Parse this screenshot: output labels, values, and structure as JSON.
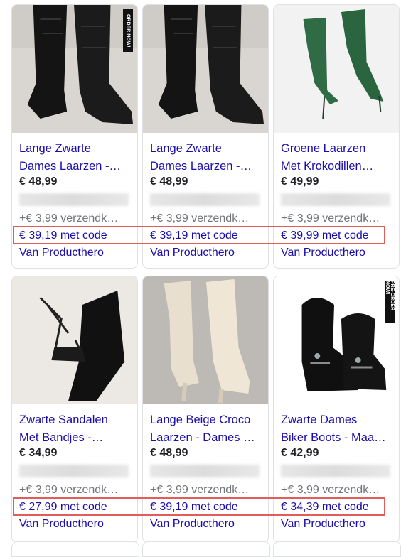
{
  "products": [
    {
      "title_line1": "Lange Zwarte",
      "title_line2": "Dames Laarzen -…",
      "price": "€ 48,99",
      "shipping": "+€ 3,99 verzendk…",
      "code_price": "€ 39,19 met code",
      "seller": "Van Producthero",
      "badge": "ORDER NOW!",
      "image": "black-croc-knee-boots"
    },
    {
      "title_line1": "Lange Zwarte",
      "title_line2": "Dames Laarzen -…",
      "price": "€ 48,99",
      "shipping": "+€ 3,99 verzendk…",
      "code_price": "€ 39,19 met code",
      "seller": "Van Producthero",
      "badge": "",
      "image": "black-croc-knee-boots"
    },
    {
      "title_line1": "Groene Laarzen",
      "title_line2": "Met Krokodillen…",
      "price": "€ 49,99",
      "shipping": "+€ 3,99 verzendk…",
      "code_price": "€ 39,99 met code",
      "seller": "Van Producthero",
      "badge": "",
      "image": "green-croc-stiletto-boots"
    },
    {
      "title_line1": "Zwarte Sandalen",
      "title_line2": "Met Bandjes -…",
      "price": "€ 34,99",
      "shipping": "+€ 3,99 verzendk…",
      "code_price": "€ 27,99 met code",
      "seller": "Van Producthero",
      "badge": "",
      "image": "black-lace-up-sandals"
    },
    {
      "title_line1": "Lange Beige Croco",
      "title_line2": "Laarzen - Dames …",
      "price": "€ 48,99",
      "shipping": "+€ 3,99 verzendk…",
      "code_price": "€ 39,19 met code",
      "seller": "Van Producthero",
      "badge": "",
      "image": "beige-croc-knee-boots"
    },
    {
      "title_line1": "Zwarte Dames",
      "title_line2": "Biker Boots - Maa…",
      "price": "€ 42,99",
      "shipping": "+€ 3,99 verzendk…",
      "code_price": "€ 34,39 met code",
      "seller": "Van Producthero",
      "badge": "PRE-ORDER NOW!",
      "image": "black-biker-boots"
    }
  ],
  "colors": {
    "link": "#1a0dab",
    "highlight": "#e25c5c",
    "border": "#dfe1e5",
    "muted": "#70757a"
  }
}
